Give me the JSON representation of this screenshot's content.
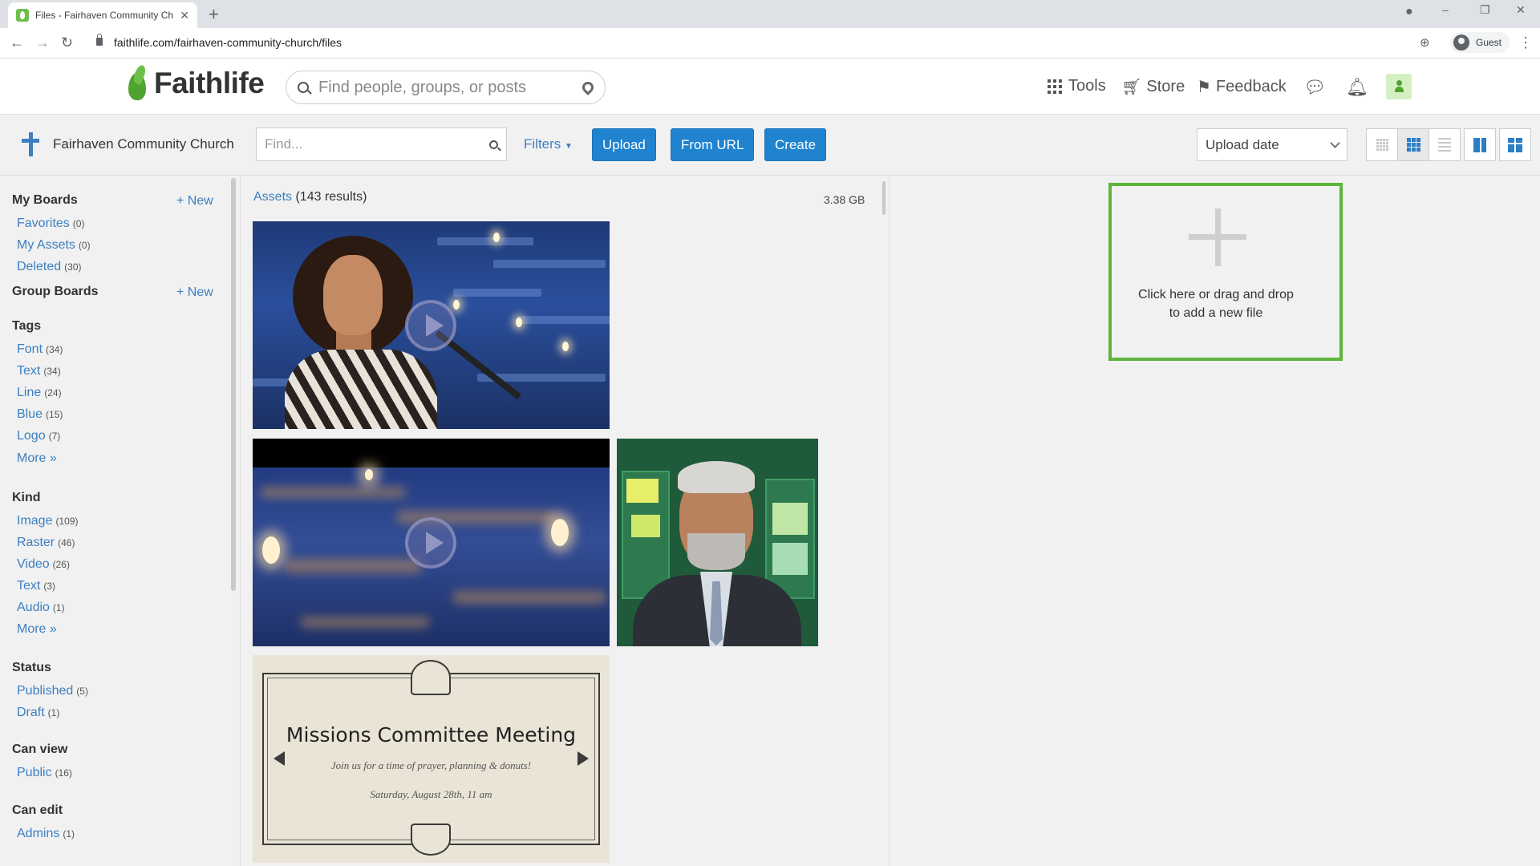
{
  "browser": {
    "tab_title": "Files - Fairhaven Community Chu",
    "url": "faithlife.com/fairhaven-community-church/files",
    "profile_label": "Guest"
  },
  "header": {
    "logo_text": "Faithlife",
    "search_placeholder": "Find people, groups, or posts",
    "nav": {
      "tools": "Tools",
      "store": "Store",
      "feedback": "Feedback"
    }
  },
  "filesbar": {
    "group_name": "Fairhaven Community Church",
    "find_placeholder": "Find...",
    "filters_label": "Filters",
    "upload_label": "Upload",
    "from_url_label": "From URL",
    "create_label": "Create",
    "sort_value": "Upload date"
  },
  "sidebar": {
    "my_boards": {
      "title": "My Boards",
      "new_label": "+ New",
      "items": [
        {
          "label": "Favorites",
          "count": "(0)"
        },
        {
          "label": "My Assets",
          "count": "(0)"
        },
        {
          "label": "Deleted",
          "count": "(30)"
        }
      ]
    },
    "group_boards": {
      "title": "Group Boards",
      "new_label": "+ New"
    },
    "tags": {
      "title": "Tags",
      "items": [
        {
          "label": "Font",
          "count": "(34)"
        },
        {
          "label": "Text",
          "count": "(34)"
        },
        {
          "label": "Line",
          "count": "(24)"
        },
        {
          "label": "Blue",
          "count": "(15)"
        },
        {
          "label": "Logo",
          "count": "(7)"
        }
      ],
      "more_label": "More »"
    },
    "kind": {
      "title": "Kind",
      "items": [
        {
          "label": "Image",
          "count": "(109)"
        },
        {
          "label": "Raster",
          "count": "(46)"
        },
        {
          "label": "Video",
          "count": "(26)"
        },
        {
          "label": "Text",
          "count": "(3)"
        },
        {
          "label": "Audio",
          "count": "(1)"
        }
      ],
      "more_label": "More »"
    },
    "status": {
      "title": "Status",
      "items": [
        {
          "label": "Published",
          "count": "(5)"
        },
        {
          "label": "Draft",
          "count": "(1)"
        }
      ]
    },
    "can_view": {
      "title": "Can view",
      "items": [
        {
          "label": "Public",
          "count": "(16)"
        }
      ]
    },
    "can_edit": {
      "title": "Can edit",
      "items": [
        {
          "label": "Admins",
          "count": "(1)"
        }
      ]
    }
  },
  "main": {
    "assets_link": "Assets",
    "results": "(143 results)",
    "storage_used": "3.38 GB",
    "invitation_card": {
      "title": "Missions Committee Meeting",
      "subtitle": "Join us for a time of prayer, planning & donuts!",
      "date": "Saturday, August 28th, 11 am"
    }
  },
  "dropzone": {
    "line1": "Click here or drag and drop",
    "line2": "to add a new file"
  },
  "colors": {
    "brand_green": "#5db53a",
    "link_blue": "#3c7fc1",
    "button_blue": "#1f83d0"
  }
}
